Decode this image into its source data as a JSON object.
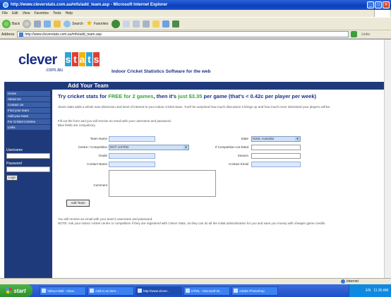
{
  "window": {
    "title": "http://www.cleverstats.com.au/mfs/add_team.asp - Microsoft Internet Explorer",
    "controls": [
      "_",
      "□",
      "✕"
    ]
  },
  "menu": [
    "File",
    "Edit",
    "View",
    "Favorites",
    "Tools",
    "Help"
  ],
  "toolbar": {
    "back": "Back",
    "search": "Search",
    "favorites": "Favorites"
  },
  "address": {
    "label": "Address",
    "url": "http://www.cleverstats.com.au/mfs/add_team.asp",
    "links": "Links"
  },
  "brand": {
    "clever": "clever",
    "stats_letters": [
      "s",
      "t",
      "a",
      "t",
      "s"
    ],
    "domain": ".com.au",
    "tagline": "Indoor Cricket Statistics Software for the web"
  },
  "page_title": "Add Your Team",
  "sidebar": {
    "nav": [
      "Home",
      "About Us",
      "Contact Us",
      "Find your team",
      "Add your team",
      "For Cricket Centres",
      "Links"
    ],
    "username_label": "Username",
    "password_label": "Password",
    "login": "Login"
  },
  "promo": {
    "part1": "Try cricket stats for ",
    "free": "FREE for 2 games",
    "part2": ", then it's ",
    "price": "just $3.35",
    "part3": " per game (that's < 0.42c per player per week)"
  },
  "paragraphs": {
    "intro": "clever stats adds a whole new dimension and level of interest to your indoor cricket team. You'll be surprised how much discussion it brings up and how much more interested your players will be.",
    "notice": "Fill out the form and you will receive an email with your username and password.",
    "blue_note": "Blue fields are compulsory.",
    "after1": "You will receive an email with your team's username and password.",
    "after2": "NOTE: Ask your indoor cricket centre or competition if they are registered with Clever Stats, as they can do all the initial administration for you and save you money with cheaper game credits."
  },
  "form": {
    "team_name": "Team Name",
    "state": "State",
    "state_value": "NSW, Australia",
    "centre": "Centre / Competition",
    "centre_value": "NOT LISTED",
    "if_not_listed": "If Competition not listed",
    "grade": "Grade",
    "season": "Season",
    "contact_name": "Contact Name",
    "contact_email": "Contact Email",
    "comment": "Comment",
    "add_team": "Add Team"
  },
  "status": {
    "zone": "Internet"
  },
  "taskbar": {
    "start": "start",
    "tasks": [
      "Yahoo! Mail - Inbox",
      "Add to an item...",
      "http://www.clever...",
      "HTML - Microsoft W...",
      "Adobe Photoshop"
    ],
    "clock": "11:35 AM",
    "lang": "EN"
  }
}
